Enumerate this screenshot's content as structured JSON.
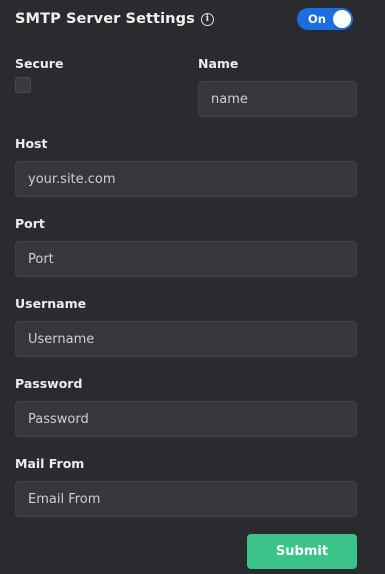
{
  "header": {
    "title": "SMTP Server Settings",
    "info_glyph": "i",
    "toggle_label": "On",
    "toggle_state": "on"
  },
  "secure": {
    "label": "Secure",
    "checked": false
  },
  "name": {
    "label": "Name",
    "placeholder": "name"
  },
  "host": {
    "label": "Host",
    "placeholder": "your.site.com"
  },
  "port": {
    "label": "Port",
    "placeholder": "Port"
  },
  "username": {
    "label": "Username",
    "placeholder": "Username"
  },
  "password": {
    "label": "Password",
    "placeholder": "Password"
  },
  "mail_from": {
    "label": "Mail From",
    "placeholder": "Email From"
  },
  "submit": {
    "label": "Submit"
  },
  "colors": {
    "background": "#2a2b2e",
    "field_background": "#36373b",
    "toggle_accent": "#1a6fe0",
    "submit_accent": "#3ac48a"
  }
}
